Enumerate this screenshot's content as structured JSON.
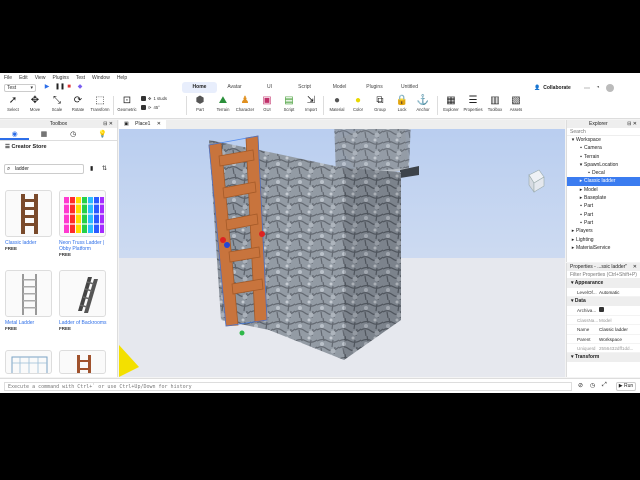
{
  "menu": [
    "File",
    "Edit",
    "View",
    "Plugins",
    "Test",
    "Window",
    "Help"
  ],
  "environment": "Test",
  "ribbon_tabs": [
    "Home",
    "Avatar",
    "UI",
    "Script",
    "Model",
    "Plugins",
    "Untitled"
  ],
  "active_tab": "Home",
  "collaborate": "Collaborate",
  "tools": {
    "select": "Select",
    "move": "Move",
    "scale": "Scale",
    "rotate": "Rotate",
    "transform": "Transform",
    "geometric": "Geometric",
    "part": "Part",
    "terrain": "Terrain",
    "character": "Character",
    "gui": "GUI",
    "script": "Script",
    "import": "Import",
    "material": "Material",
    "color": "Color",
    "group": "Group",
    "lock": "Lock",
    "anchor": "Anchor",
    "explorer": "Explorer",
    "properties": "Properties",
    "toolbox": "Toolbox",
    "assets": "Assets"
  },
  "snap": {
    "move": "1 studs",
    "rotate": "45°"
  },
  "toolbox": {
    "title": "Toolbox",
    "section": "Creator Store",
    "search": "ladder",
    "items": [
      {
        "name": "Classic ladder",
        "price": "FREE"
      },
      {
        "name": "Neon Truss Ladder | Obby Platform",
        "price": "FREE"
      },
      {
        "name": "Metal Ladder",
        "price": "FREE"
      },
      {
        "name": "Ladder of Backrooms",
        "price": "FREE"
      }
    ]
  },
  "doc_tab": "Place1",
  "explorer": {
    "title": "Explorer",
    "search": "Search",
    "items": [
      {
        "label": "Workspace",
        "indent": 0,
        "icon": "▾"
      },
      {
        "label": "Camera",
        "indent": 1,
        "icon": "▪"
      },
      {
        "label": "Terrain",
        "indent": 1,
        "icon": "▪"
      },
      {
        "label": "SpawnLocation",
        "indent": 1,
        "icon": "▾"
      },
      {
        "label": "Decal",
        "indent": 2,
        "icon": "▪"
      },
      {
        "label": "Classic ladder",
        "indent": 1,
        "icon": "▸",
        "selected": true
      },
      {
        "label": "Model",
        "indent": 1,
        "icon": "▸"
      },
      {
        "label": "Baseplate",
        "indent": 1,
        "icon": "▸"
      },
      {
        "label": "Part",
        "indent": 1,
        "icon": "▪"
      },
      {
        "label": "Part",
        "indent": 1,
        "icon": "▪"
      },
      {
        "label": "Part",
        "indent": 1,
        "icon": "▪"
      },
      {
        "label": "Players",
        "indent": 0,
        "icon": "▸"
      },
      {
        "label": "Lighting",
        "indent": 0,
        "icon": "▸"
      },
      {
        "label": "MaterialService",
        "indent": 0,
        "icon": "▸"
      }
    ]
  },
  "properties": {
    "title": "Properties - ...ssic ladder\"",
    "filter": "Filter Properties (Ctrl+Shift+P)",
    "appearance": "Appearance",
    "level_of": "LevelOf...",
    "level_val": "Automatic",
    "data": "Data",
    "archivable": "Archiva...",
    "class_k": "ClassNa...",
    "class_v": "Model",
    "name_k": "Name",
    "name_v": "Classic ladder",
    "parent_k": "Parent",
    "parent_v": "Workspace",
    "uid_k": "UniqueId",
    "uid_v": "2556432dff1dd...",
    "transform": "Transform"
  },
  "command_placeholder": "Execute a command with Ctrl+` or use Ctrl+Up/Down for history",
  "run": "Run",
  "colors": {
    "accent": "#3b7cf0",
    "ladder": "#c8743d",
    "sky": "#c9d7f0"
  }
}
